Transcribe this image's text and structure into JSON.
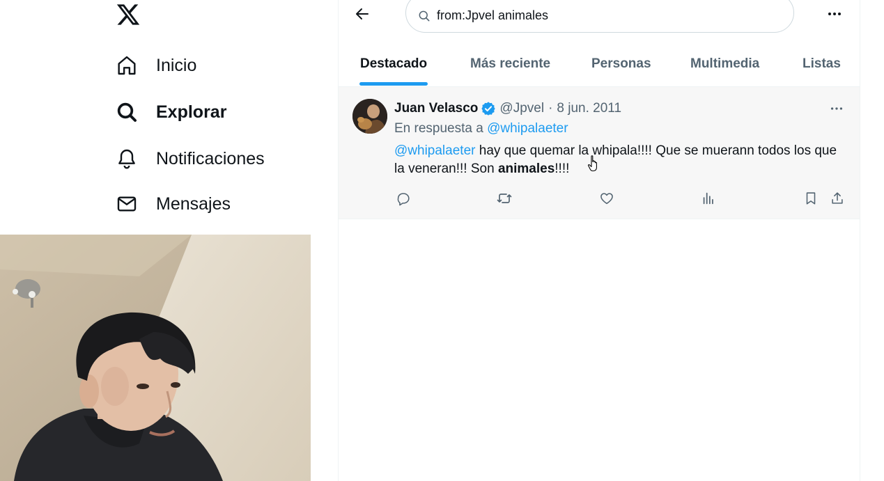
{
  "nav": {
    "logo": "x-logo",
    "items": [
      {
        "label": "Inicio",
        "icon": "home-icon"
      },
      {
        "label": "Explorar",
        "icon": "search-icon"
      },
      {
        "label": "Notificaciones",
        "icon": "bell-icon"
      },
      {
        "label": "Mensajes",
        "icon": "mail-icon"
      }
    ]
  },
  "search": {
    "value": "from:Jpvel animales"
  },
  "tabs": [
    "Destacado",
    "Más reciente",
    "Personas",
    "Multimedia",
    "Listas"
  ],
  "tweet": {
    "author_name": "Juan Velasco",
    "handle": "@Jpvel",
    "separator": "·",
    "date": "8 jun. 2011",
    "reply_prefix": "En respuesta a",
    "reply_handle": "@whipalaeter",
    "mention": "@whipalaeter",
    "text_part1": " hay que quemar la whipala!!!! Que se muerann todos los que la veneran!!! Son ",
    "text_bold": "animales",
    "text_part2": "!!!!"
  },
  "colors": {
    "accent": "#1d9bf0",
    "text_primary": "#0f1419",
    "text_secondary": "#536471",
    "tweet_background": "#f7f7f7"
  }
}
